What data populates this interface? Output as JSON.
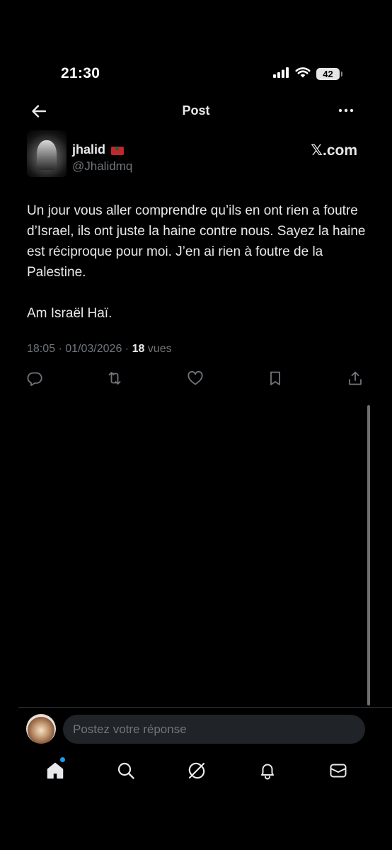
{
  "status_bar": {
    "time": "21:30",
    "battery": "42"
  },
  "header": {
    "title": "Post"
  },
  "author": {
    "name": "jhalid",
    "handle": "@Jhalidmq"
  },
  "source": {
    "label": "𝕏.com"
  },
  "post": {
    "text": "Un jour vous aller comprendre qu’ils en ont rien a foutre d’Israel,  ils ont juste la haine contre nous. Sayez la haine est réciproque pour moi. J’en ai rien à foutre de la Palestine.\n\nAm Israël Haï.",
    "timestamp": "18:05 · 01/03/2026 · ",
    "views_count": "18",
    "views_label": " vues"
  },
  "reply": {
    "placeholder": "Postez votre réponse"
  },
  "colors": {
    "background": "#000000",
    "text": "#e7e9ea",
    "secondary": "#71767b",
    "accent": "#1d9bf0"
  },
  "icons": {
    "actions": [
      "reply-icon",
      "repost-icon",
      "like-icon",
      "bookmark-icon",
      "share-icon"
    ],
    "tabs": [
      "home-icon",
      "search-icon",
      "grok-icon",
      "notifications-icon",
      "messages-icon"
    ]
  }
}
